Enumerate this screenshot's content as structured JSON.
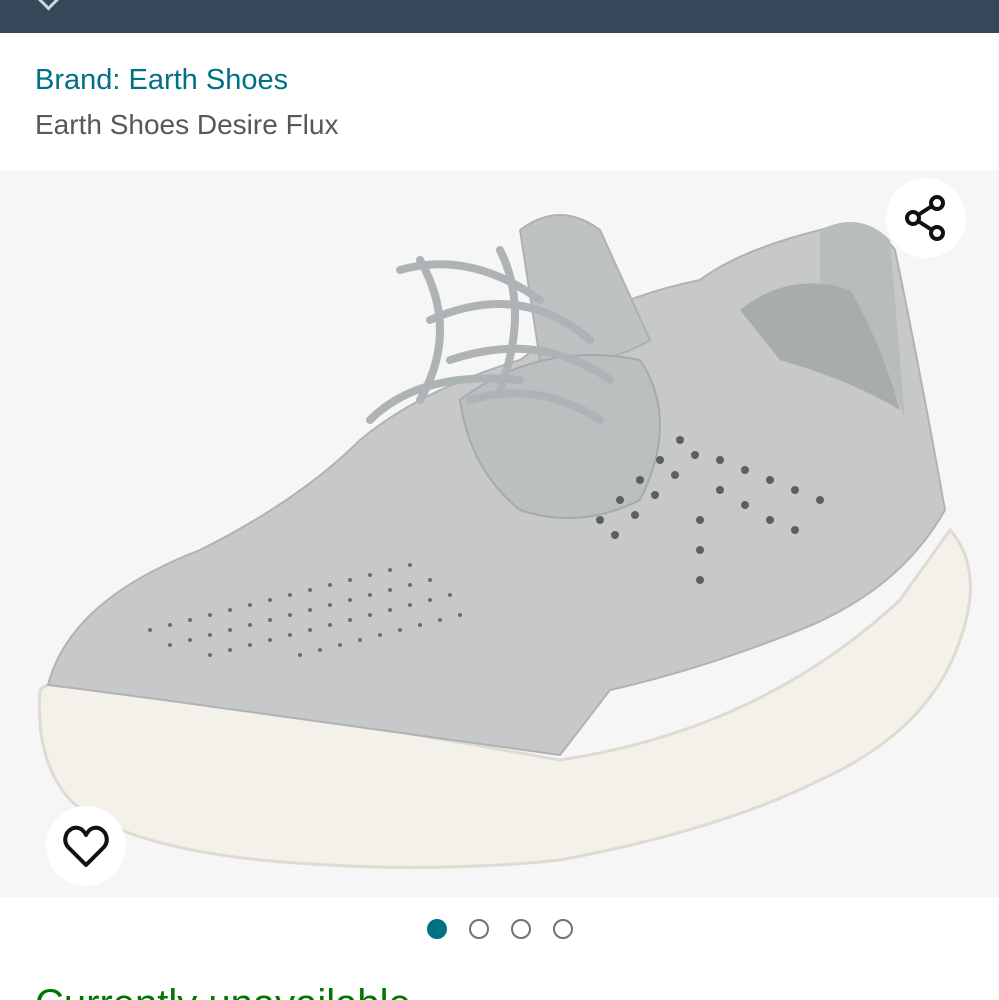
{
  "header": {
    "brand_link": "Brand: Earth Shoes",
    "product_title": "Earth Shoes Desire Flux"
  },
  "image_carousel": {
    "image_count": 4,
    "active_index": 0,
    "share_icon": "share-icon",
    "wishlist_icon": "heart-icon"
  },
  "availability": {
    "text": "Currently unavailable."
  },
  "colors": {
    "top_bar": "#37475a",
    "link": "#007185",
    "title": "#565959",
    "availability": "#007600"
  }
}
